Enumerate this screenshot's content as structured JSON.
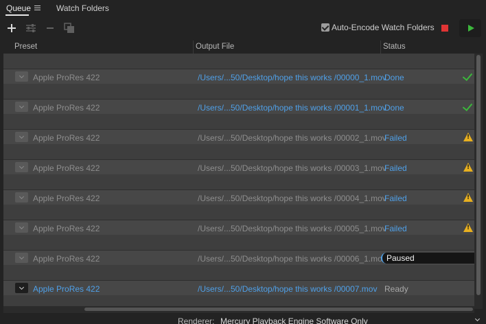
{
  "tabs": {
    "queue": "Queue",
    "watch_folders": "Watch Folders"
  },
  "toolbar": {
    "add_icon": "plus-icon",
    "settings_icon": "preset-settings-icon",
    "remove_icon": "minus-icon",
    "duplicate_icon": "duplicate-icon",
    "auto_encode_label": "Auto-Encode Watch Folders",
    "auto_encode_checked": true,
    "stop_color": "#e03434",
    "play_color": "#3cb73c"
  },
  "columns": {
    "preset": "Preset",
    "output_file": "Output File",
    "status": "Status"
  },
  "rows": [
    {
      "preset": "Apple ProRes 422",
      "file": "/Users/...50/Desktop/hope this works /00000_1.mov",
      "status": "Done",
      "icon": "check"
    },
    {
      "preset": "Apple ProRes 422",
      "file": "/Users/...50/Desktop/hope this works /00001_1.mov",
      "status": "Done",
      "icon": "check"
    },
    {
      "preset": "Apple ProRes 422",
      "file": "/Users/...50/Desktop/hope this works /00002_1.mov",
      "status": "Failed",
      "icon": "warning"
    },
    {
      "preset": "Apple ProRes 422",
      "file": "/Users/...50/Desktop/hope this works /00003_1.mov",
      "status": "Failed",
      "icon": "warning"
    },
    {
      "preset": "Apple ProRes 422",
      "file": "/Users/...50/Desktop/hope this works /00004_1.mov",
      "status": "Failed",
      "icon": "warning"
    },
    {
      "preset": "Apple ProRes 422",
      "file": "/Users/...50/Desktop/hope this works /00005_1.mov",
      "status": "Failed",
      "icon": "warning"
    },
    {
      "preset": "Apple ProRes 422",
      "file": "/Users/...50/Desktop/hope this works /00006_1.mov",
      "status": "Paused",
      "icon": ""
    },
    {
      "preset": "Apple ProRes 422",
      "file": "/Users/...50/Desktop/hope this works /00007.mov",
      "status": "Ready",
      "icon": ""
    }
  ],
  "footer": {
    "renderer_label": "Renderer:",
    "renderer_value": "Mercury Playback Engine Software Only"
  }
}
